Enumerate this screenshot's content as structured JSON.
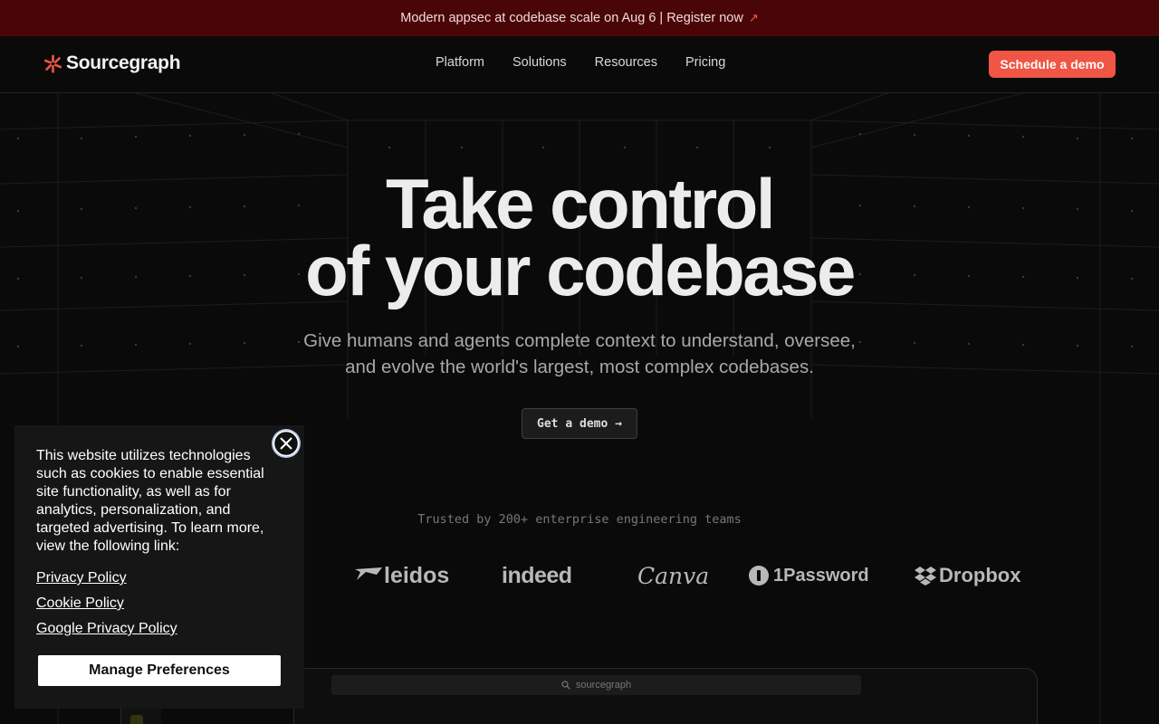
{
  "banner": {
    "text": "Modern appsec at codebase scale on Aug 6 | Register now",
    "arrow": "↗"
  },
  "nav": {
    "brand": "Sourcegraph",
    "links": [
      "Platform",
      "Solutions",
      "Resources",
      "Pricing"
    ],
    "cta": "Schedule a demo"
  },
  "hero": {
    "headline_line1": "Take control",
    "headline_line2": "of your codebase",
    "sub_line1": "Give humans and agents complete context to understand, oversee,",
    "sub_line2": "and evolve the world's largest, most complex codebases.",
    "cta": "Get a demo →"
  },
  "trusted": {
    "text": "Trusted by 200+ enterprise engineering teams",
    "logos": [
      "leidos",
      "indeed",
      "Canva",
      "1Password",
      "Dropbox"
    ]
  },
  "app_preview": {
    "search_text": "sourcegraph"
  },
  "cookie": {
    "message": "This website utilizes technologies such as cookies to enable essential site functionality, as well as for analytics, personalization, and targeted advertising. To learn more, view the following link:",
    "links": [
      "Privacy Policy",
      "Cookie Policy",
      "Google Privacy Policy"
    ],
    "manage": "Manage Preferences"
  },
  "colors": {
    "banner_bg": "#4a0508",
    "accent": "#f05545",
    "page_bg": "#0a0a0a"
  },
  "icons": [
    "sourcegraph-logo-icon",
    "arrow-up-right-icon",
    "search-icon",
    "close-icon",
    "onepassword-icon",
    "dropbox-icon",
    "leidos-icon"
  ]
}
